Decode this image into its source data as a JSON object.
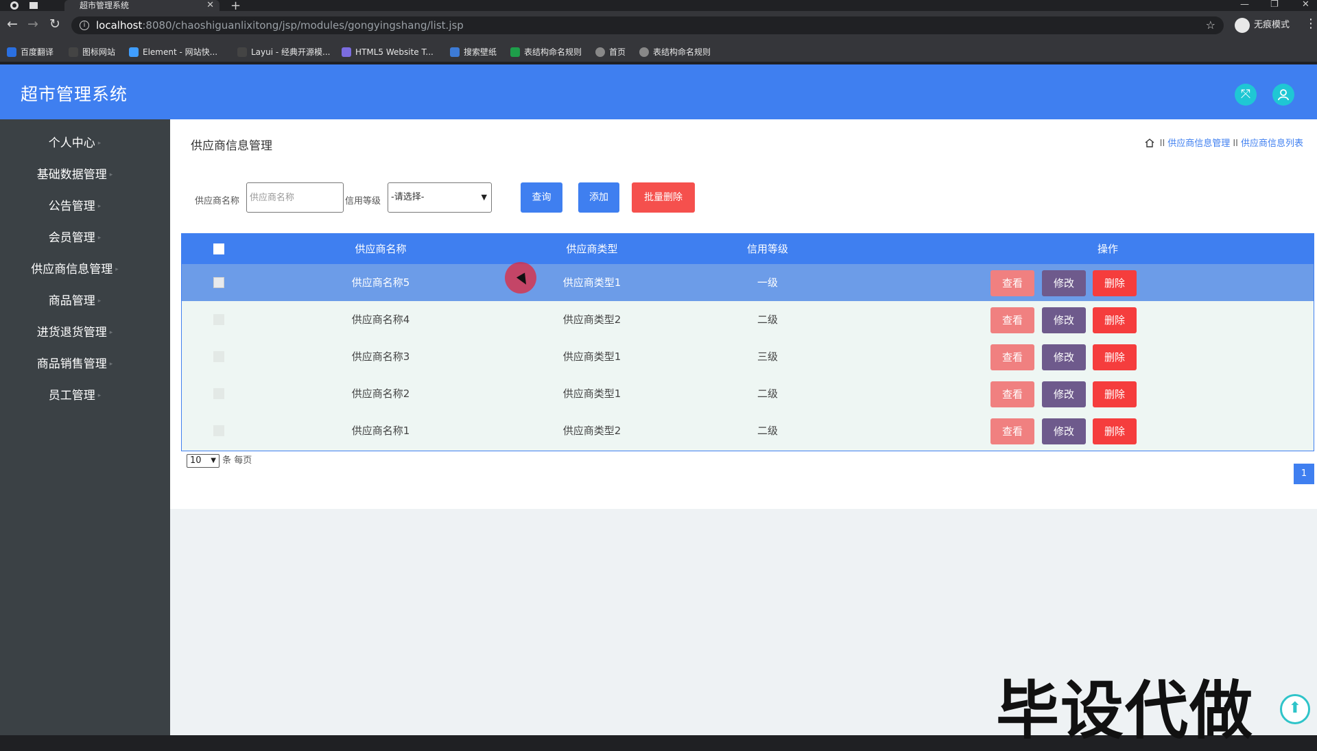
{
  "browser": {
    "tab_title": "超市管理系统",
    "tab_close": "✕",
    "new_tab": "+",
    "url_host": "localhost",
    "url_path": ":8080/chaoshiguanlixitong/jsp/modules/gongyingshang/list.jsp",
    "incognito_label": "无痕模式",
    "bookmarks": [
      {
        "label": "百度翻译",
        "color": "#2a6fe0"
      },
      {
        "label": "图标网站",
        "color": "#444"
      },
      {
        "label": "Element - 网站快...",
        "color": "#409eff"
      },
      {
        "label": "Layui - 经典开源模...",
        "color": "#444"
      },
      {
        "label": "HTML5 Website T...",
        "color": "#7b6ce0"
      },
      {
        "label": "搜索壁纸",
        "color": "#3d7bd6"
      },
      {
        "label": "表结构命名规则",
        "color": "#1e9e4a"
      },
      {
        "label": "首页",
        "color": "#555"
      },
      {
        "label": "表结构命名规则",
        "color": "#555"
      }
    ]
  },
  "app": {
    "title": "超市管理系统",
    "colors": {
      "primary": "#3f7ff0",
      "sidebar": "#3b4145",
      "danger": "#f53d3d"
    }
  },
  "sidebar": {
    "items": [
      {
        "label": "个人中心"
      },
      {
        "label": "基础数据管理"
      },
      {
        "label": "公告管理"
      },
      {
        "label": "会员管理"
      },
      {
        "label": "供应商信息管理"
      },
      {
        "label": "商品管理"
      },
      {
        "label": "进货退货管理"
      },
      {
        "label": "商品销售管理"
      },
      {
        "label": "员工管理"
      }
    ]
  },
  "page": {
    "title": "供应商信息管理",
    "breadcrumb": [
      "供应商信息管理",
      "供应商信息列表"
    ],
    "breadcrumb_sep": "II"
  },
  "search": {
    "name_label": "供应商名称",
    "name_placeholder": "供应商名称",
    "level_label": "信用等级",
    "level_selected": "-请选择-",
    "query_btn": "查询",
    "add_btn": "添加",
    "batch_delete_btn": "批量删除"
  },
  "table": {
    "columns": [
      "供应商名称",
      "供应商类型",
      "信用等级",
      "操作"
    ],
    "actions": {
      "view": "查看",
      "edit": "修改",
      "delete": "删除"
    },
    "rows": [
      {
        "name": "供应商名称5",
        "type": "供应商类型1",
        "level": "一级"
      },
      {
        "name": "供应商名称4",
        "type": "供应商类型2",
        "level": "二级"
      },
      {
        "name": "供应商名称3",
        "type": "供应商类型1",
        "level": "三级"
      },
      {
        "name": "供应商名称2",
        "type": "供应商类型1",
        "level": "二级"
      },
      {
        "name": "供应商名称1",
        "type": "供应商类型2",
        "level": "二级"
      }
    ]
  },
  "pagination": {
    "page_size": "10",
    "per_page_label": "条 每页",
    "current_page": "1"
  },
  "watermark": "毕设代做"
}
